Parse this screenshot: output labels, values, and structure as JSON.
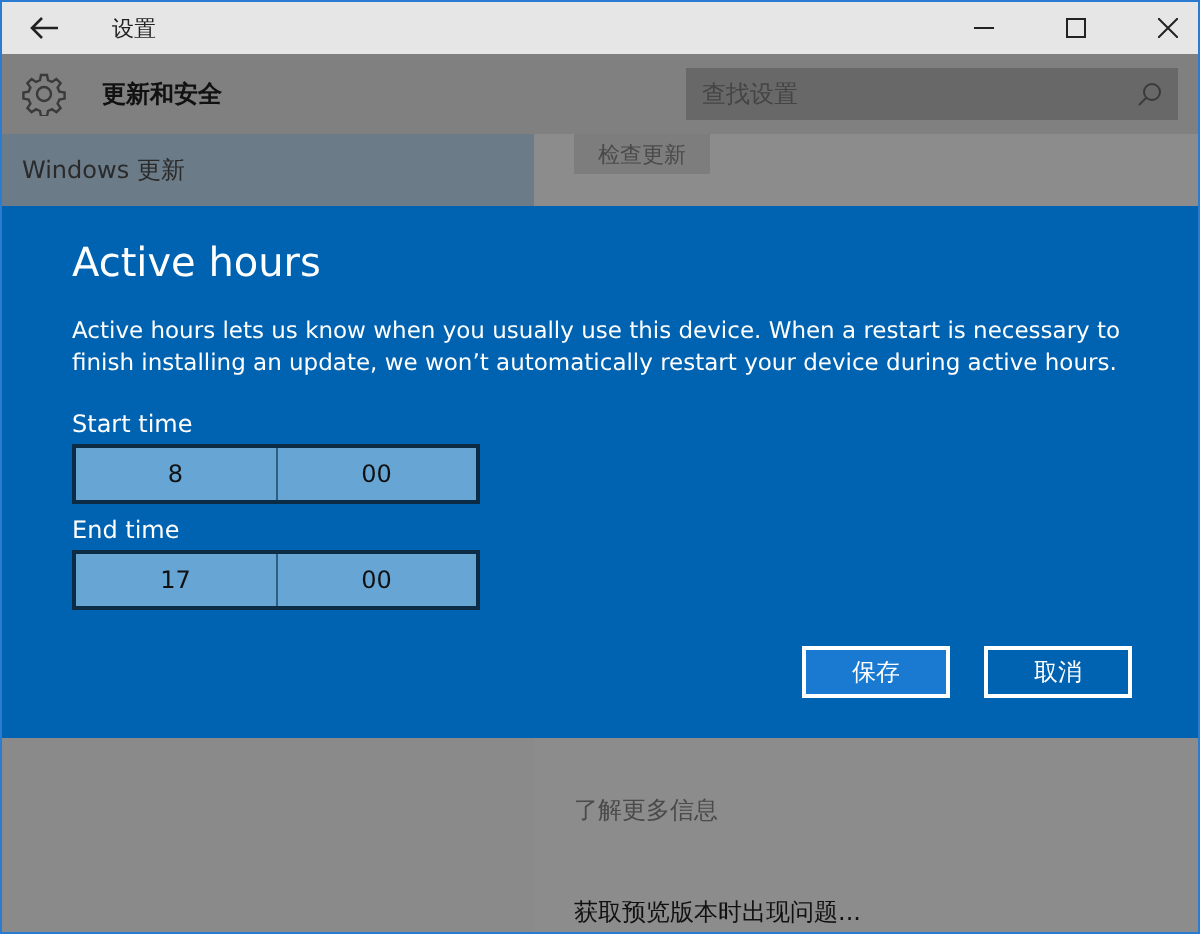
{
  "window": {
    "title": "设置"
  },
  "header": {
    "title": "更新和安全",
    "search": {
      "placeholder": "查找设置"
    }
  },
  "sidebar": {
    "items": [
      {
        "label": "Windows 更新",
        "selected": true
      }
    ]
  },
  "content": {
    "check_button": "检查更新",
    "learn_more": "了解更多信息",
    "preview_issue": "获取预览版本时出现问题..."
  },
  "dialog": {
    "title": "Active hours",
    "description": "Active hours lets us know when you usually use this device. When a restart is necessary to finish installing an update, we won’t automatically restart your device during active hours.",
    "fields": [
      {
        "label": "Start time",
        "hour": "8",
        "minute": "00"
      },
      {
        "label": "End time",
        "hour": "17",
        "minute": "00"
      }
    ],
    "buttons": [
      {
        "label": "保存",
        "primary": true
      },
      {
        "label": "取消",
        "primary": false
      }
    ]
  }
}
